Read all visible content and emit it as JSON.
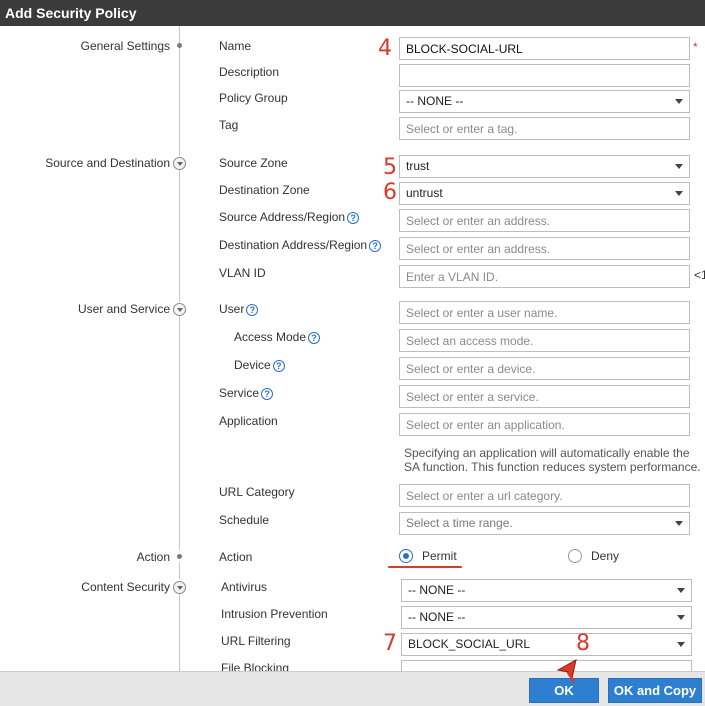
{
  "dialog": {
    "title": "Add Security Policy"
  },
  "sections": {
    "general": "General Settings",
    "source_dest": "Source and Destination",
    "user_service": "User and Service",
    "action": "Action",
    "content_security": "Content Security"
  },
  "annotations": {
    "s4": "4",
    "s5": "5",
    "s6": "6",
    "s7": "7",
    "s8": "8",
    "required": "*"
  },
  "general": {
    "name_label": "Name",
    "name_value": "BLOCK-SOCIAL-URL",
    "description_label": "Description",
    "description_value": "",
    "policy_group_label": "Policy Group",
    "policy_group_value": "-- NONE --",
    "tag_label": "Tag",
    "tag_placeholder": "Select or enter a tag."
  },
  "source_dest": {
    "source_zone_label": "Source Zone",
    "source_zone_value": "trust",
    "dest_zone_label": "Destination Zone",
    "dest_zone_value": "untrust",
    "source_addr_label": "Source Address/Region",
    "source_addr_placeholder": "Select or enter an address.",
    "dest_addr_label": "Destination Address/Region",
    "dest_addr_placeholder": "Select or enter an address.",
    "vlan_label": "VLAN ID",
    "vlan_placeholder": "Enter a VLAN ID.",
    "vlan_suffix": "<1"
  },
  "user_service": {
    "user_label": "User",
    "user_placeholder": "Select or enter a user name.",
    "access_mode_label": "Access Mode",
    "access_mode_placeholder": "Select an access mode.",
    "device_label": "Device",
    "device_placeholder": "Select or enter a device.",
    "service_label": "Service",
    "service_placeholder": "Select or enter a service.",
    "application_label": "Application",
    "application_placeholder": "Select or enter an application.",
    "application_note_1": "Specifying an application will automatically enable the",
    "application_note_2": "SA function. This function reduces system performance.",
    "url_category_label": "URL Category",
    "url_category_placeholder": "Select or enter a url category.",
    "schedule_label": "Schedule",
    "schedule_placeholder": "Select a time range."
  },
  "action": {
    "label": "Action",
    "permit": "Permit",
    "deny": "Deny",
    "selected": "Permit"
  },
  "content_security": {
    "antivirus_label": "Antivirus",
    "antivirus_value": "-- NONE --",
    "ips_label": "Intrusion Prevention",
    "ips_value": "-- NONE --",
    "url_filtering_label": "URL Filtering",
    "url_filtering_value": "BLOCK_SOCIAL_URL",
    "file_blocking_label": "File Blocking"
  },
  "footer": {
    "ok": "OK",
    "ok_copy": "OK and Copy"
  },
  "colors": {
    "accent": "#2f7fd1",
    "annotation": "#d93a2b",
    "titlebar": "#3b3b3b"
  }
}
